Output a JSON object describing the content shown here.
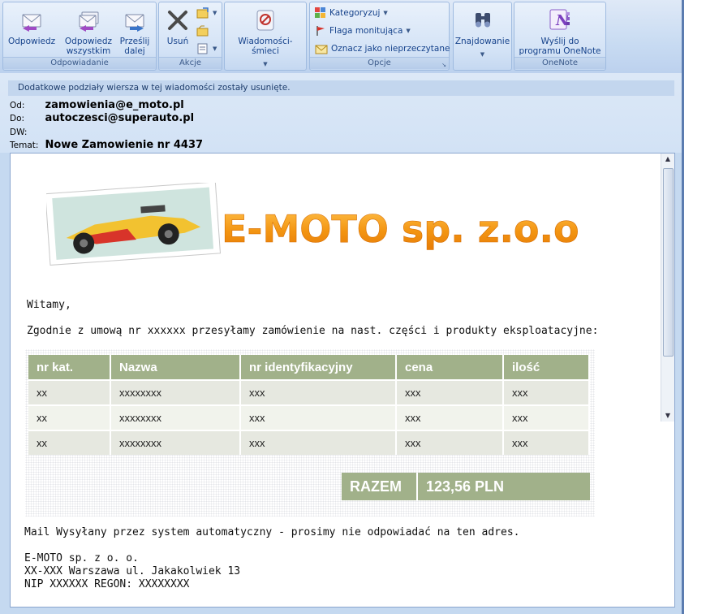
{
  "ribbon": {
    "groups": {
      "respond": "Odpowiadanie",
      "actions": "Akcje",
      "options": "Opcje",
      "onenote": "OneNote"
    },
    "buttons": {
      "reply": "Odpowiedz",
      "reply_all_1": "Odpowiedz",
      "reply_all_2": "wszystkim",
      "forward_1": "Prześlij",
      "forward_2": "dalej",
      "delete": "Usuń",
      "junk": "Wiadomości-śmieci",
      "categorize": "Kategoryzuj",
      "followup": "Flaga monitująca",
      "mark_unread": "Oznacz jako nieprzeczytane",
      "find": "Znajdowanie",
      "onenote_1": "Wyślij do",
      "onenote_2": "programu OneNote"
    }
  },
  "header": {
    "info": "Dodatkowe podziały wiersza w tej wiadomości zostały usunięte.",
    "from_label": "Od:",
    "from": "zamowienia@e_moto.pl",
    "to_label": "Do:",
    "to": "autoczesci@superauto.pl",
    "cc_label": "DW:",
    "cc": "",
    "subject_label": "Temat:",
    "subject": "Nowe Zamowienie nr 4437"
  },
  "message": {
    "logo_text": "E-MOTO sp. z.o.o",
    "greeting": "Witamy,",
    "intro": "Zgodnie z umową nr xxxxxx przesyłamy zamówienie na nast. części i produkty eksploatacyjne:",
    "table": {
      "headers": [
        "nr kat.",
        "Nazwa",
        "nr identyfikacyjny",
        "cena",
        "ilość"
      ],
      "rows": [
        [
          "xx",
          "xxxxxxxx",
          "xxx",
          "xxx",
          "xxx"
        ],
        [
          "xx",
          "xxxxxxxx",
          "xxx",
          "xxx",
          "xxx"
        ],
        [
          "xx",
          "xxxxxxxx",
          "xxx",
          "xxx",
          "xxx"
        ]
      ]
    },
    "total_label": "RAZEM",
    "total_value": "123,56 PLN",
    "footer": "Mail Wysyłany przez system automatyczny - prosimy nie odpowiadać na ten adres.",
    "company": "E-MOTO sp. z o. o.",
    "address": "XX-XXX Warszawa ul. Jakakolwiek 13",
    "ids": "NIP XXXXXX REGON: XXXXXXXX"
  },
  "colors": {
    "accent": "#a1b18a",
    "ribbon": "#c8dbf2",
    "label": "#15428b",
    "logo": "#f59a1b"
  }
}
